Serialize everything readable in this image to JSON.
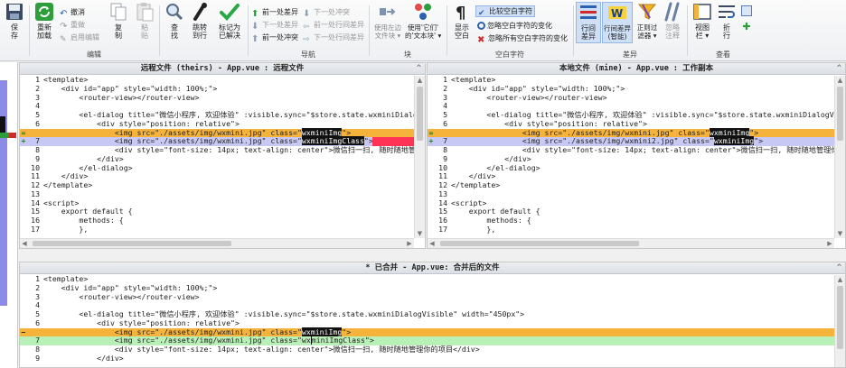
{
  "ribbon": {
    "file": {
      "save": "保\n存"
    },
    "edit": {
      "reload": "重新\n加载",
      "undo": "撤消",
      "redo": "重做",
      "enable_edit": "启用编辑",
      "copy": "复\n制",
      "paste": "粘\n贴",
      "label": "编辑"
    },
    "find": {
      "find": "查\n找",
      "goto": "跳转\n到行",
      "mark_resolved": "标记为\n已解决"
    },
    "nav": {
      "prev_diff": "前一处差异",
      "next_conflict": "下一处冲突",
      "next_diff": "下一处差异",
      "prev_line_diff": "前一处行间差异",
      "prev_conflict": "前一处冲突",
      "next_line_diff": "下一处行间差异",
      "label": "导航"
    },
    "block": {
      "use_left": "使用左边\n文件块 ▾",
      "use_both": "使用'它们'\n的'文本块' ▾",
      "label": "块"
    },
    "whitespace": {
      "show": "显示\n空白",
      "compare": "比较空白字符",
      "ignore_changes": "忽略空白字符的变化",
      "ignore_all": "忽略所有空白字符的变化",
      "label": "空白字符"
    },
    "diff": {
      "inline": "行间\n差异",
      "inline_smart": "行间差异\n(智能)",
      "regex": "正则过\n滤器 ▾",
      "ignore_comments": "忽略\n注释",
      "label": "差异"
    },
    "view": {
      "view_bar": "视图\n栏 ▾",
      "fold": "折\n行",
      "label": "查看"
    }
  },
  "panes": {
    "theirs": {
      "title": "远程文件 (theirs) - App.vue : 远程文件"
    },
    "mine": {
      "title": "本地文件 (mine) - App.vue : 工作副本"
    },
    "merged": {
      "title": "* 已合并 - App.vue: 合并后的文件"
    }
  },
  "code": {
    "l1": "<template>",
    "l2": "    <div id=\"app\" style=\"width: 100%;\">",
    "l3": "        <router-view></router-view>",
    "l4": "",
    "l5": "        <el-dialog title=\"微信小程序, 欢迎体验\" :visible.sync=\"$store.state.wxminiDialogVisible\" width=\"450px\">",
    "l6": "            <div style=\"position: relative\">",
    "l7a": "                <img src=\"./assets/img/wxmini.jpg\" class=\"",
    "l7b": "wxminiImg",
    "l7c": "\">",
    "l8a_theirs": "                <img src=\"./assets/img/wxmini.jpg\" class=\"",
    "l8b_theirs": "wxminiImgClass",
    "l8c": "\">",
    "l8a_mine": "                <img src=\"./assets/img/wxmini2.jpg\" class=\"",
    "l8b_mine": "wxminiImg",
    "l8a_merged": "                <img src=\"./assets/img/wxmini.jpg\" class=\"wx",
    "l8b_merged": "m",
    "l8c_merged": "iniImgClass\">",
    "l9": "                <div style=\"font-size: 14px; text-align: center\">微信扫一扫, 随时随地管理你的项目</div>",
    "l10": "            </div>",
    "l11": "        </el-dialog>",
    "l12": "    </div>",
    "l13": "</template>",
    "l14": "",
    "l15": "<script>",
    "l16": "    export default {",
    "l17": "        methods: {",
    "l18": "        },"
  },
  "markers": {
    "conflict": "=",
    "plus": "+",
    "minus": "−"
  },
  "line_numbers": [
    "1",
    "2",
    "3",
    "4",
    "5",
    "6",
    "7",
    "8",
    "9",
    "10",
    "11",
    "12",
    "13",
    "14",
    "15",
    "16",
    "17"
  ],
  "colors": {
    "conflict": "#f6b33c",
    "changed": "#c8c8f4",
    "added": "#b8f0b8",
    "red": "#ff3355"
  }
}
